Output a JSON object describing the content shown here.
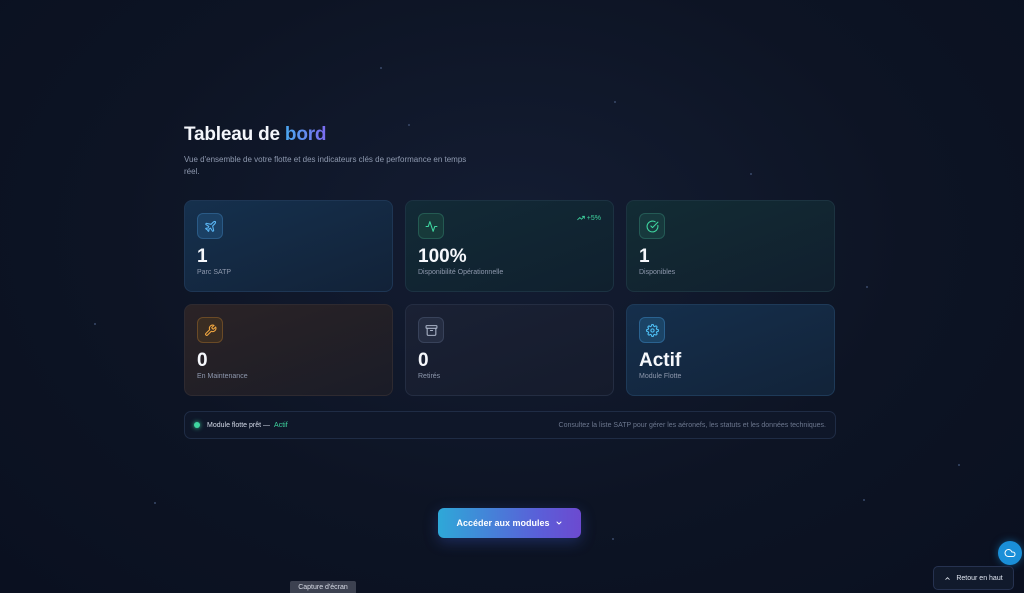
{
  "header": {
    "title_main": "Tableau de ",
    "title_accent": "bord",
    "subtitle": "Vue d'ensemble de votre flotte et des indicateurs clés de performance en temps réel."
  },
  "cards": [
    {
      "icon": "plane-icon",
      "value": "1",
      "label": "Parc SATP"
    },
    {
      "icon": "activity-icon",
      "value": "100%",
      "label": "Disponibilité Opérationnelle",
      "trend": "+5%"
    },
    {
      "icon": "check-circle-icon",
      "value": "1",
      "label": "Disponibles"
    },
    {
      "icon": "wrench-icon",
      "value": "0",
      "label": "En Maintenance"
    },
    {
      "icon": "archive-icon",
      "value": "0",
      "label": "Retirés"
    },
    {
      "icon": "gear-icon",
      "value": "Actif",
      "label": "Module Flotte"
    }
  ],
  "status": {
    "text": "Module flotte prêt —",
    "active": "Actif",
    "hint": "Consultez la liste SATP pour gérer les aéronefs, les statuts et les données techniques."
  },
  "cta": {
    "label": "Accéder aux modules"
  },
  "back_to_top": {
    "label": "Retour en haut"
  },
  "capture": {
    "label": "Capture d'écran"
  },
  "colors": {
    "accent_green": "#3fd6a0",
    "accent_blue": "#4aa8f0",
    "accent_purple": "#7c6cf0",
    "accent_orange": "#f0a640"
  }
}
